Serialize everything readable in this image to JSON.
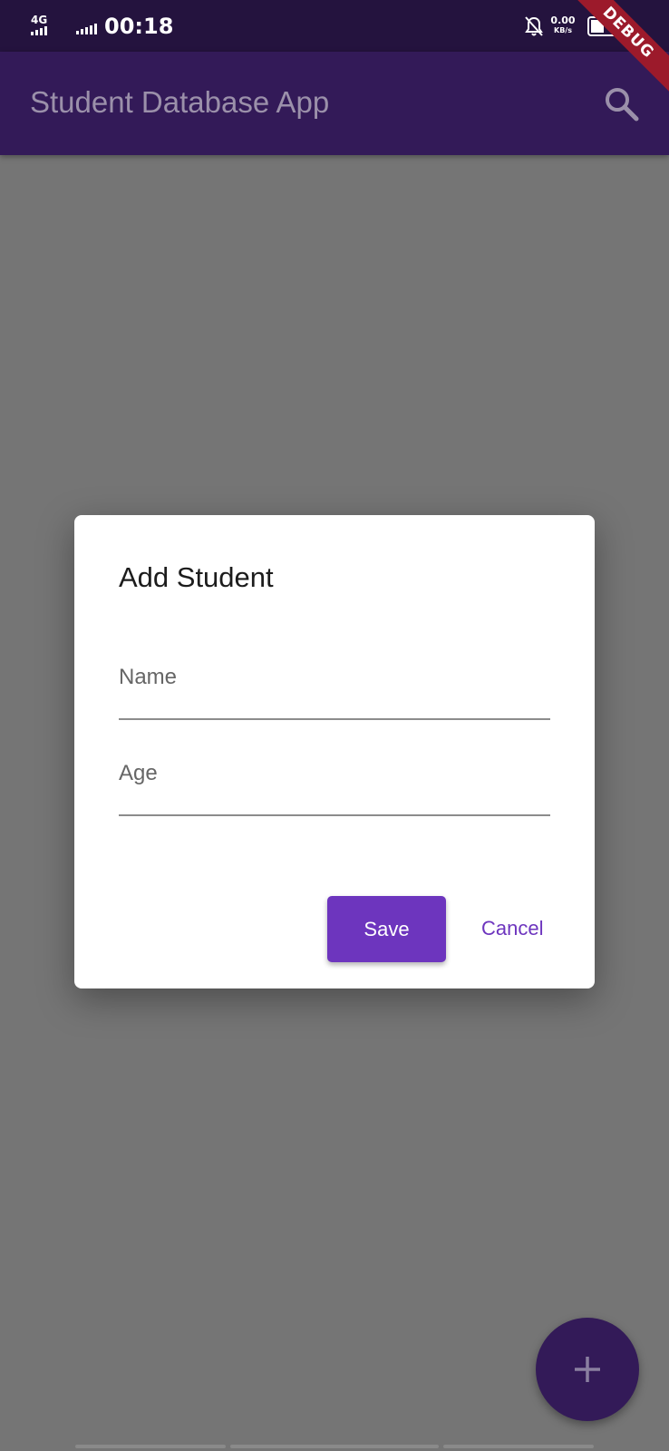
{
  "status_bar": {
    "network": "4G",
    "time": "00:18",
    "speed_value": "0.00",
    "speed_unit": "KB/s",
    "icons": [
      "signal-icon",
      "signal-icon",
      "bell-off-icon",
      "battery-icon"
    ]
  },
  "app_bar": {
    "title": "Student Database App",
    "search_icon": "search-icon"
  },
  "debug_banner": {
    "label": "DEBUG"
  },
  "dialog": {
    "title": "Add Student",
    "fields": [
      {
        "label": "Name",
        "value": ""
      },
      {
        "label": "Age",
        "value": ""
      }
    ],
    "save_label": "Save",
    "cancel_label": "Cancel"
  },
  "fab": {
    "icon": "plus-icon"
  },
  "colors": {
    "primary_dark": "#24133e",
    "primary": "#331a58",
    "accent": "#6d35be",
    "debug": "#9c1a2b",
    "scrim": "#757575"
  }
}
